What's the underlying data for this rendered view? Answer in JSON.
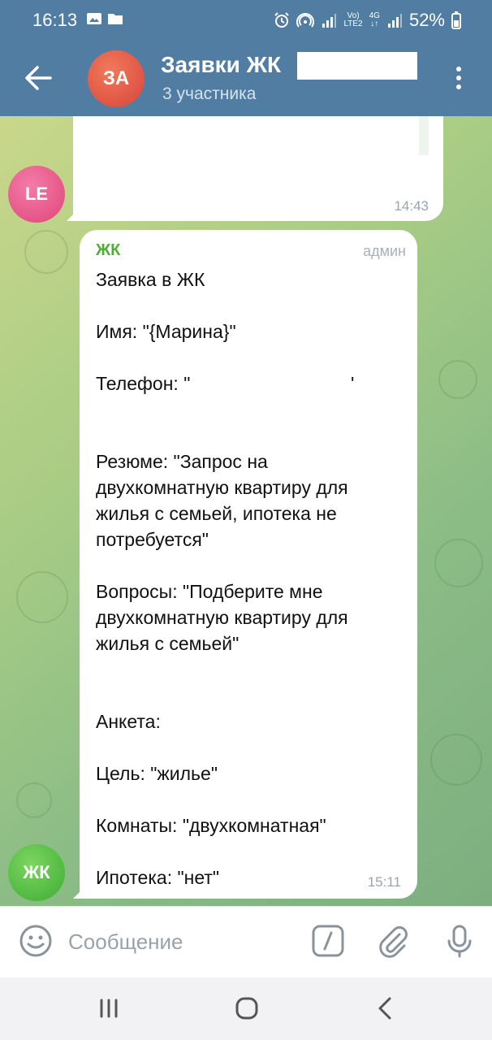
{
  "status_bar": {
    "time": "16:13",
    "network_vo": "Vo)",
    "network_lte": "LTE2",
    "network_4g": "4G",
    "battery": "52%"
  },
  "header": {
    "avatar_initials": "ЗА",
    "title": "Заявки ЖК",
    "subtitle": "3 участника"
  },
  "messages": {
    "prev": {
      "avatar_initials": "LE",
      "time": "14:43"
    },
    "main": {
      "avatar_initials": "ЖК",
      "sender": "ЖК",
      "role": "админ",
      "time": "15:11",
      "lines": [
        "Заявка в ЖК",
        "Имя: \"{Марина}\"",
        "Телефон: \"",
        "'",
        "Резюме: \"Запрос на",
        "двухкомнатную квартиру для",
        "жилья с семьей, ипотека не",
        "потребуется\"",
        "Вопросы: \"Подберите мне",
        "двухкомнатную квартиру для",
        "жилья с семьей\"",
        "Анкета:",
        "Цель: \"жилье\"",
        "Комнаты: \"двухкомнатная\"",
        "Ипотека: \"нет\""
      ]
    }
  },
  "input": {
    "placeholder": "Сообщение"
  },
  "colors": {
    "header": "#517DA2",
    "sender": "#4fae35",
    "accent_avatar_group": "#d9443b"
  }
}
